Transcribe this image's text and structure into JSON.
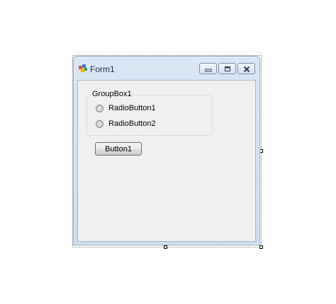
{
  "window": {
    "title": "Form1",
    "icon": "form-icon",
    "caption_buttons": [
      "minimize-icon",
      "maximize-icon",
      "close-icon"
    ]
  },
  "groupbox": {
    "title": "GroupBox1",
    "radios": [
      {
        "label": "RadioButton1",
        "checked": false
      },
      {
        "label": "RadioButton2",
        "checked": false
      }
    ]
  },
  "button": {
    "label": "Button1"
  }
}
